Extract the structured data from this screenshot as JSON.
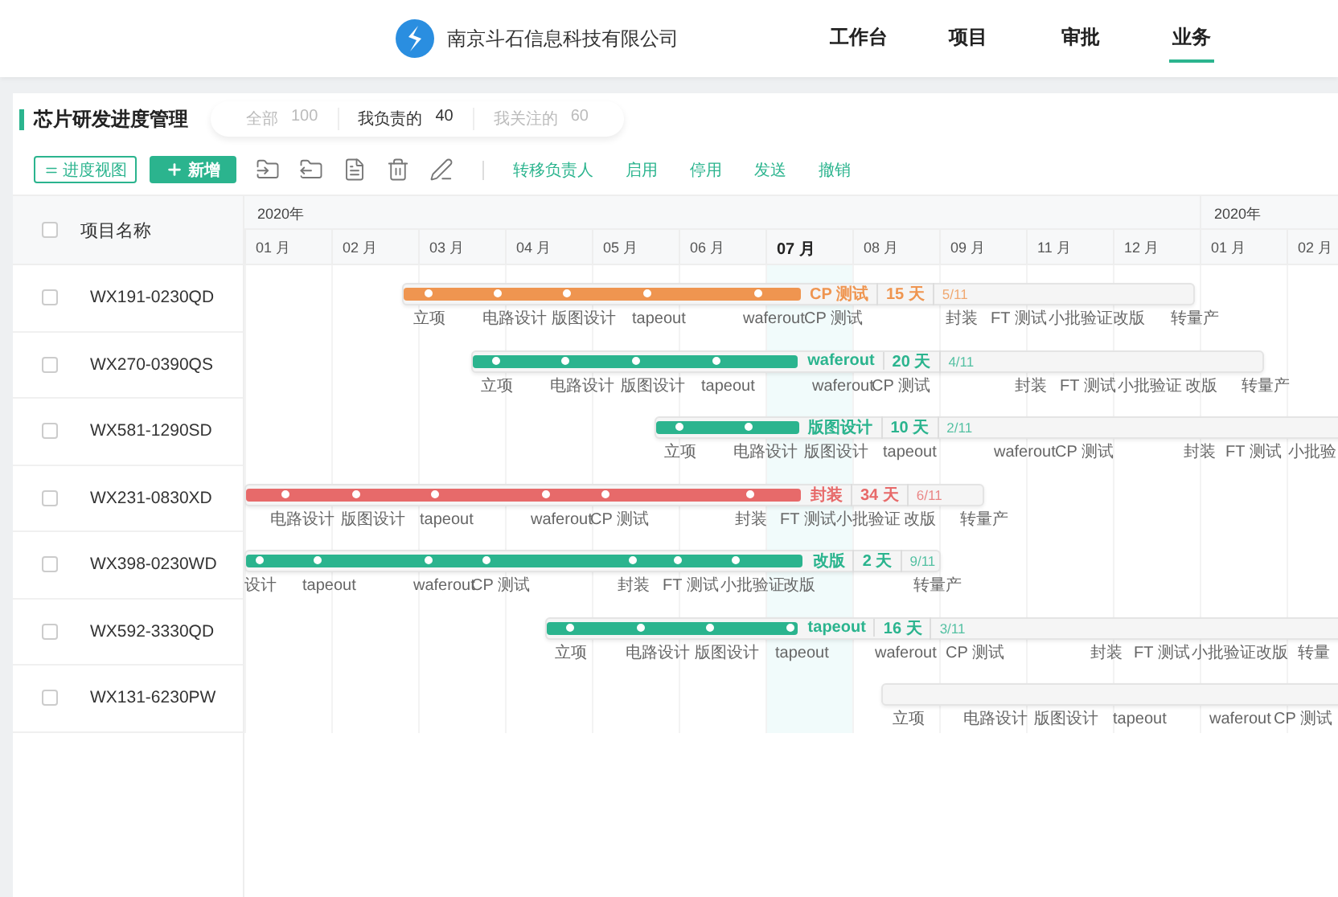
{
  "header": {
    "company": "南京斗石信息科技有限公司",
    "nav": [
      {
        "label": "工作台",
        "selected": false
      },
      {
        "label": "项目",
        "selected": false
      },
      {
        "label": "审批",
        "selected": false
      },
      {
        "label": "业务",
        "selected": true
      }
    ]
  },
  "page": {
    "title": "芯片研发进度管理",
    "filters": [
      {
        "label": "全部",
        "count": "100",
        "selected": false
      },
      {
        "label": "我负责的",
        "count": "40",
        "selected": true
      },
      {
        "label": "我关注的",
        "count": "60",
        "selected": false
      }
    ]
  },
  "toolbar": {
    "view_button": "进度视图",
    "add_button": "新增",
    "actions": [
      "转移负责人",
      "启用",
      "停用",
      "发送",
      "撤销"
    ]
  },
  "table": {
    "name_header": "项目名称",
    "header_checked": false,
    "years": [
      {
        "label": "2020年",
        "months": [
          {
            "label": "01 月",
            "current": false
          },
          {
            "label": "02 月",
            "current": false
          },
          {
            "label": "03 月",
            "current": false
          },
          {
            "label": "04 月",
            "current": false
          },
          {
            "label": "05 月",
            "current": false
          },
          {
            "label": "06 月",
            "current": false
          },
          {
            "label": "07 月",
            "current": true
          },
          {
            "label": "08 月",
            "current": false
          },
          {
            "label": "09 月",
            "current": false
          },
          {
            "label": "11 月",
            "current": false
          },
          {
            "label": "12 月",
            "current": false
          }
        ]
      },
      {
        "label": "2020年",
        "months": [
          {
            "label": "01 月",
            "current": false
          },
          {
            "label": "02 月",
            "current": false
          }
        ]
      }
    ],
    "rows": [
      {
        "name": "WX191-0230QD",
        "checked": false,
        "color": "#ef9550",
        "level": 0.5,
        "phase": "CP 测试",
        "days": "15 天",
        "progress": "5/11",
        "milestones": [
          "立项",
          "电路设计",
          "版图设计",
          "tapeout",
          "waferout",
          "CP 测试",
          "封装",
          "FT 测试",
          "小批验证",
          "改版",
          "转量产"
        ]
      },
      {
        "name": "WX270-0390QS",
        "checked": false,
        "color": "#2bb48e",
        "level": 0.41,
        "phase": "waferout",
        "days": "20 天",
        "progress": "4/11",
        "milestones": [
          "立项",
          "电路设计",
          "版图设计",
          "tapeout",
          "waferout",
          "CP 测试",
          "封装",
          "FT 测试",
          "小批验证",
          "改版",
          "转量产"
        ]
      },
      {
        "name": "WX581-1290SD",
        "checked": false,
        "color": "#2bb48e",
        "level": 0.18,
        "phase": "版图设计",
        "days": "10 天",
        "progress": "2/11",
        "milestones": [
          "立项",
          "电路设计",
          "版图设计",
          "tapeout",
          "waferout",
          "CP 测试",
          "封装",
          "FT 测试",
          "小批验"
        ]
      },
      {
        "name": "WX231-0830XD",
        "checked": false,
        "color": "#e76a6a",
        "level": 0.75,
        "phase": "封装",
        "days": "34 天",
        "progress": "6/11",
        "milestones": [
          "电路设计",
          "版图设计",
          "tapeout",
          "waferout",
          "CP 测试",
          "封装",
          "FT 测试",
          "小批验证",
          "改版",
          "转量产"
        ]
      },
      {
        "name": "WX398-0230WD",
        "checked": false,
        "color": "#2bb48e",
        "level": 0.8,
        "phase": "改版",
        "days": "2 天",
        "progress": "9/11",
        "milestones": [
          "设计",
          "tapeout",
          "waferout",
          "CP 测试",
          "封装",
          "FT 测试",
          "小批验证",
          "改版",
          "转量产"
        ]
      },
      {
        "name": "WX592-3330QD",
        "checked": false,
        "color": "#2bb48e",
        "level": 0.3,
        "phase": "tapeout",
        "days": "16 天",
        "progress": "3/11",
        "milestones": [
          "立项",
          "电路设计",
          "版图设计",
          "tapeout",
          "waferout",
          "CP 测试",
          "封装",
          "FT 测试",
          "小批验证",
          "改版",
          "转量"
        ]
      },
      {
        "name": "WX131-6230PW",
        "checked": false,
        "milestones": [
          "立项",
          "电路设计",
          "版图设计",
          "tapeout",
          "waferout",
          "CP 测试"
        ]
      }
    ]
  }
}
